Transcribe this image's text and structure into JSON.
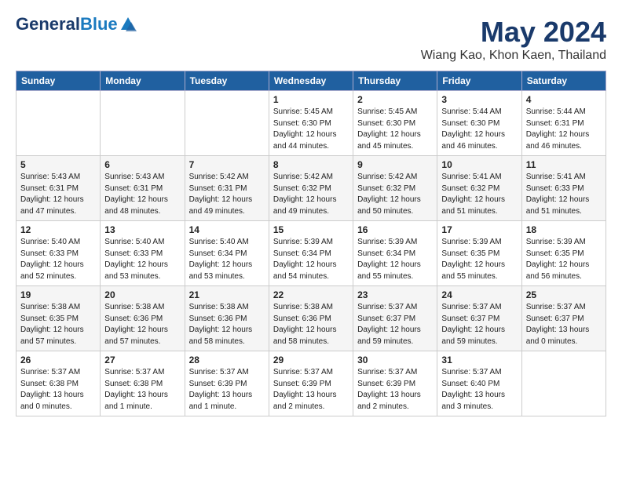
{
  "header": {
    "logo_general": "General",
    "logo_blue": "Blue",
    "month_title": "May 2024",
    "location": "Wiang Kao, Khon Kaen, Thailand"
  },
  "days_of_week": [
    "Sunday",
    "Monday",
    "Tuesday",
    "Wednesday",
    "Thursday",
    "Friday",
    "Saturday"
  ],
  "weeks": [
    [
      {
        "num": "",
        "detail": ""
      },
      {
        "num": "",
        "detail": ""
      },
      {
        "num": "",
        "detail": ""
      },
      {
        "num": "1",
        "detail": "Sunrise: 5:45 AM\nSunset: 6:30 PM\nDaylight: 12 hours\nand 44 minutes."
      },
      {
        "num": "2",
        "detail": "Sunrise: 5:45 AM\nSunset: 6:30 PM\nDaylight: 12 hours\nand 45 minutes."
      },
      {
        "num": "3",
        "detail": "Sunrise: 5:44 AM\nSunset: 6:30 PM\nDaylight: 12 hours\nand 46 minutes."
      },
      {
        "num": "4",
        "detail": "Sunrise: 5:44 AM\nSunset: 6:31 PM\nDaylight: 12 hours\nand 46 minutes."
      }
    ],
    [
      {
        "num": "5",
        "detail": "Sunrise: 5:43 AM\nSunset: 6:31 PM\nDaylight: 12 hours\nand 47 minutes."
      },
      {
        "num": "6",
        "detail": "Sunrise: 5:43 AM\nSunset: 6:31 PM\nDaylight: 12 hours\nand 48 minutes."
      },
      {
        "num": "7",
        "detail": "Sunrise: 5:42 AM\nSunset: 6:31 PM\nDaylight: 12 hours\nand 49 minutes."
      },
      {
        "num": "8",
        "detail": "Sunrise: 5:42 AM\nSunset: 6:32 PM\nDaylight: 12 hours\nand 49 minutes."
      },
      {
        "num": "9",
        "detail": "Sunrise: 5:42 AM\nSunset: 6:32 PM\nDaylight: 12 hours\nand 50 minutes."
      },
      {
        "num": "10",
        "detail": "Sunrise: 5:41 AM\nSunset: 6:32 PM\nDaylight: 12 hours\nand 51 minutes."
      },
      {
        "num": "11",
        "detail": "Sunrise: 5:41 AM\nSunset: 6:33 PM\nDaylight: 12 hours\nand 51 minutes."
      }
    ],
    [
      {
        "num": "12",
        "detail": "Sunrise: 5:40 AM\nSunset: 6:33 PM\nDaylight: 12 hours\nand 52 minutes."
      },
      {
        "num": "13",
        "detail": "Sunrise: 5:40 AM\nSunset: 6:33 PM\nDaylight: 12 hours\nand 53 minutes."
      },
      {
        "num": "14",
        "detail": "Sunrise: 5:40 AM\nSunset: 6:34 PM\nDaylight: 12 hours\nand 53 minutes."
      },
      {
        "num": "15",
        "detail": "Sunrise: 5:39 AM\nSunset: 6:34 PM\nDaylight: 12 hours\nand 54 minutes."
      },
      {
        "num": "16",
        "detail": "Sunrise: 5:39 AM\nSunset: 6:34 PM\nDaylight: 12 hours\nand 55 minutes."
      },
      {
        "num": "17",
        "detail": "Sunrise: 5:39 AM\nSunset: 6:35 PM\nDaylight: 12 hours\nand 55 minutes."
      },
      {
        "num": "18",
        "detail": "Sunrise: 5:39 AM\nSunset: 6:35 PM\nDaylight: 12 hours\nand 56 minutes."
      }
    ],
    [
      {
        "num": "19",
        "detail": "Sunrise: 5:38 AM\nSunset: 6:35 PM\nDaylight: 12 hours\nand 57 minutes."
      },
      {
        "num": "20",
        "detail": "Sunrise: 5:38 AM\nSunset: 6:36 PM\nDaylight: 12 hours\nand 57 minutes."
      },
      {
        "num": "21",
        "detail": "Sunrise: 5:38 AM\nSunset: 6:36 PM\nDaylight: 12 hours\nand 58 minutes."
      },
      {
        "num": "22",
        "detail": "Sunrise: 5:38 AM\nSunset: 6:36 PM\nDaylight: 12 hours\nand 58 minutes."
      },
      {
        "num": "23",
        "detail": "Sunrise: 5:37 AM\nSunset: 6:37 PM\nDaylight: 12 hours\nand 59 minutes."
      },
      {
        "num": "24",
        "detail": "Sunrise: 5:37 AM\nSunset: 6:37 PM\nDaylight: 12 hours\nand 59 minutes."
      },
      {
        "num": "25",
        "detail": "Sunrise: 5:37 AM\nSunset: 6:37 PM\nDaylight: 13 hours\nand 0 minutes."
      }
    ],
    [
      {
        "num": "26",
        "detail": "Sunrise: 5:37 AM\nSunset: 6:38 PM\nDaylight: 13 hours\nand 0 minutes."
      },
      {
        "num": "27",
        "detail": "Sunrise: 5:37 AM\nSunset: 6:38 PM\nDaylight: 13 hours\nand 1 minute."
      },
      {
        "num": "28",
        "detail": "Sunrise: 5:37 AM\nSunset: 6:39 PM\nDaylight: 13 hours\nand 1 minute."
      },
      {
        "num": "29",
        "detail": "Sunrise: 5:37 AM\nSunset: 6:39 PM\nDaylight: 13 hours\nand 2 minutes."
      },
      {
        "num": "30",
        "detail": "Sunrise: 5:37 AM\nSunset: 6:39 PM\nDaylight: 13 hours\nand 2 minutes."
      },
      {
        "num": "31",
        "detail": "Sunrise: 5:37 AM\nSunset: 6:40 PM\nDaylight: 13 hours\nand 3 minutes."
      },
      {
        "num": "",
        "detail": ""
      }
    ]
  ]
}
